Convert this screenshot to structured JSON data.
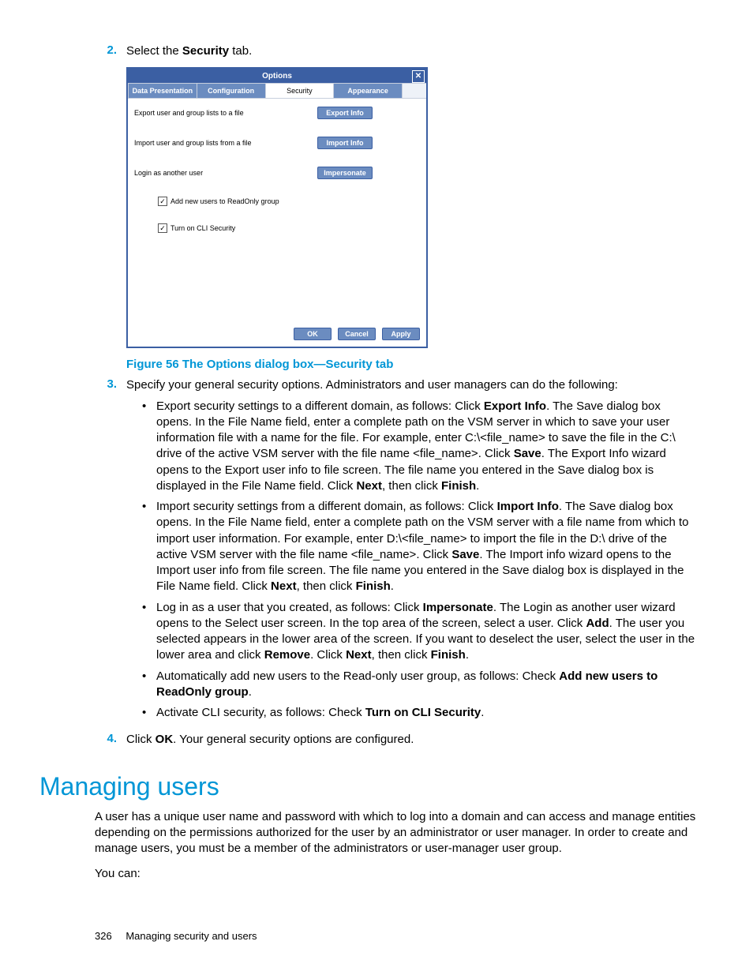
{
  "steps": {
    "s2_num": "2.",
    "s2_a": "Select the ",
    "s2_b": "Security",
    "s2_c": " tab.",
    "s3_num": "3.",
    "s3_text": "Specify your general security options. Administrators and user managers can do the following:",
    "s4_num": "4.",
    "s4_a": "Click ",
    "s4_b": "OK",
    "s4_c": ". Your general security options are configured."
  },
  "dialog": {
    "title": "Options",
    "close": "✕",
    "tabs": {
      "t1": "Data Presentation",
      "t2": "Configuration",
      "t3": "Security",
      "t4": "Appearance"
    },
    "rows": {
      "r1": "Export user and group lists to a file",
      "b1": "Export Info",
      "r2": "Import user and group lists from a file",
      "b2": "Import Info",
      "r3": "Login as another user",
      "b3": "Impersonate",
      "c1mark": "✓",
      "c1": "Add new users to ReadOnly group",
      "c2mark": "✓",
      "c2": "Turn on CLI Security"
    },
    "footer": {
      "ok": "OK",
      "cancel": "Cancel",
      "apply": "Apply"
    }
  },
  "caption": "Figure 56 The Options dialog box—Security tab",
  "bullets": {
    "b1": {
      "p1": "Export security settings to a different domain, as follows: Click ",
      "s1": "Export Info",
      "p2": ". The Save dialog box opens. In the File Name field, enter a complete path on the VSM server in which to save your user information file with a name for the file. For example, enter C:\\<file_name> to save the file in the C:\\ drive of the active VSM server with the file name <file_name>. Click ",
      "s2": "Save",
      "p3": ". The Export Info wizard opens to the Export user info to file screen. The file name you entered in the Save dialog box is displayed in the File Name field. Click ",
      "s3": "Next",
      "p4": ", then click ",
      "s4": "Finish",
      "p5": "."
    },
    "b2": {
      "p1": "Import security settings from a different domain, as follows: Click ",
      "s1": "Import Info",
      "p2": ". The Save dialog box opens. In the File Name field, enter a complete path on the VSM server with a file name from which to import user information. For example, enter D:\\<file_name> to import the file in the D:\\ drive of the active VSM server with the file name <file_name>. Click ",
      "s2": "Save",
      "p3": ". The Import info wizard opens to the Import user info from file screen. The file name you entered in the Save dialog box is displayed in the File Name field. Click ",
      "s3": "Next",
      "p4": ", then click ",
      "s4": "Finish",
      "p5": "."
    },
    "b3": {
      "p1": "Log in as a user that you created, as follows: Click ",
      "s1": "Impersonate",
      "p2": ". The Login as another user wizard opens to the Select user screen. In the top area of the screen, select a user. Click ",
      "s2": "Add",
      "p3": ". The user you selected appears in the lower area of the screen. If you want to deselect the user, select the user in the lower area and click ",
      "s3": "Remove",
      "p4": ". Click ",
      "s4": "Next",
      "p5": ", then click ",
      "s5": "Finish",
      "p6": "."
    },
    "b4": {
      "p1": "Automatically add new users to the Read-only user group, as follows: Check ",
      "s1": "Add new users to ReadOnly group",
      "p2": "."
    },
    "b5": {
      "p1": "Activate CLI security, as follows: Check ",
      "s1": "Turn on CLI Security",
      "p2": "."
    }
  },
  "heading": "Managing users",
  "para1": "A user has a unique user name and password with which to log into a domain and can access and manage entities depending on the permissions authorized for the user by an administrator or user manager. In order to create and manage users, you must be a member of the administrators or user-manager user group.",
  "para2": "You can:",
  "footer": {
    "page": "326",
    "title": "Managing security and users"
  }
}
